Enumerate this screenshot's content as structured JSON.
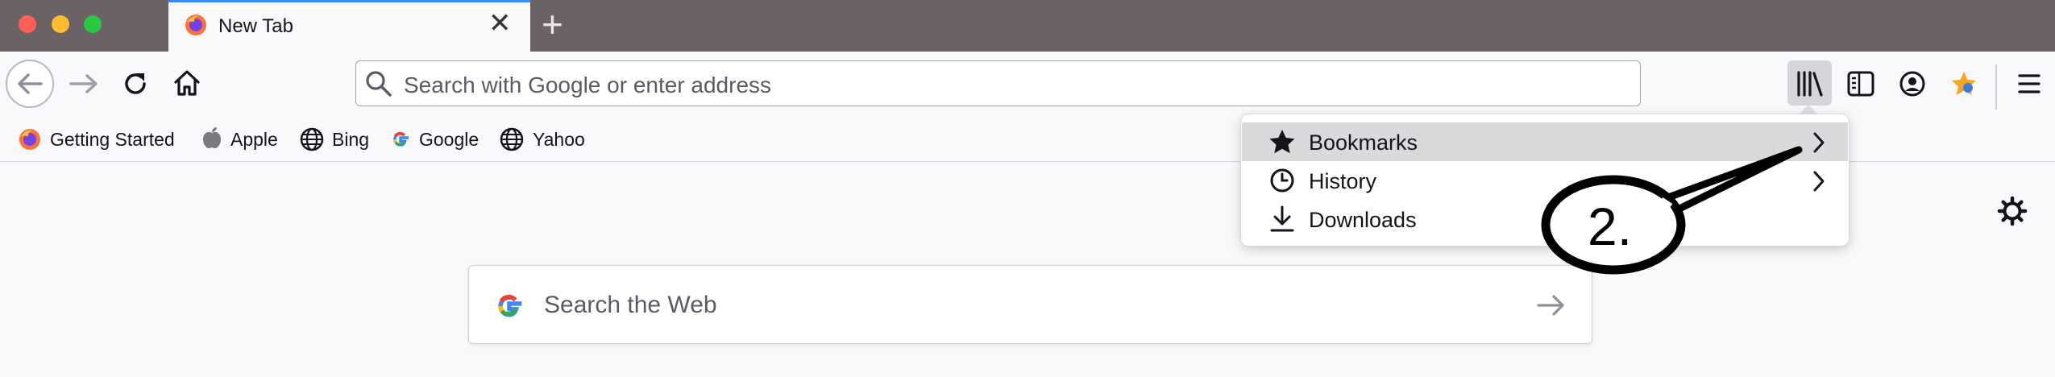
{
  "colors": {
    "tabstrip": "#6a6265",
    "toolbar": "#f9f9fb",
    "tab_accent": "#3a8bff",
    "close_red": "#ff5f57",
    "minimize_yellow": "#febc2e",
    "maximize_green": "#28c840",
    "panel_highlight": "#dadadd"
  },
  "window": {
    "tab_title": "New Tab",
    "new_tab_symbol": "+",
    "close_tab_symbol": "✕"
  },
  "urlbar": {
    "placeholder": "Search with Google or enter address"
  },
  "bookmarks": [
    {
      "label": "Getting Started",
      "icon": "firefox-icon"
    },
    {
      "label": "Apple",
      "icon": "apple-icon"
    },
    {
      "label": "Bing",
      "icon": "globe-icon"
    },
    {
      "label": "Google",
      "icon": "google-icon"
    },
    {
      "label": "Yahoo",
      "icon": "globe-icon"
    }
  ],
  "toolbar_icons": [
    "library-icon",
    "sidebar-icon",
    "account-icon",
    "extension-star-icon",
    "menu-icon"
  ],
  "library_menu": {
    "items": [
      {
        "label": "Bookmarks",
        "icon": "star-icon",
        "has_submenu": true,
        "highlighted": true
      },
      {
        "label": "History",
        "icon": "clock-icon",
        "has_submenu": true,
        "highlighted": false
      },
      {
        "label": "Downloads",
        "icon": "download-icon",
        "has_submenu": false,
        "highlighted": false
      }
    ]
  },
  "newtab": {
    "search_placeholder": "Search the Web",
    "settings_icon": "gear-icon"
  },
  "annotation": {
    "callout_label": "2."
  }
}
